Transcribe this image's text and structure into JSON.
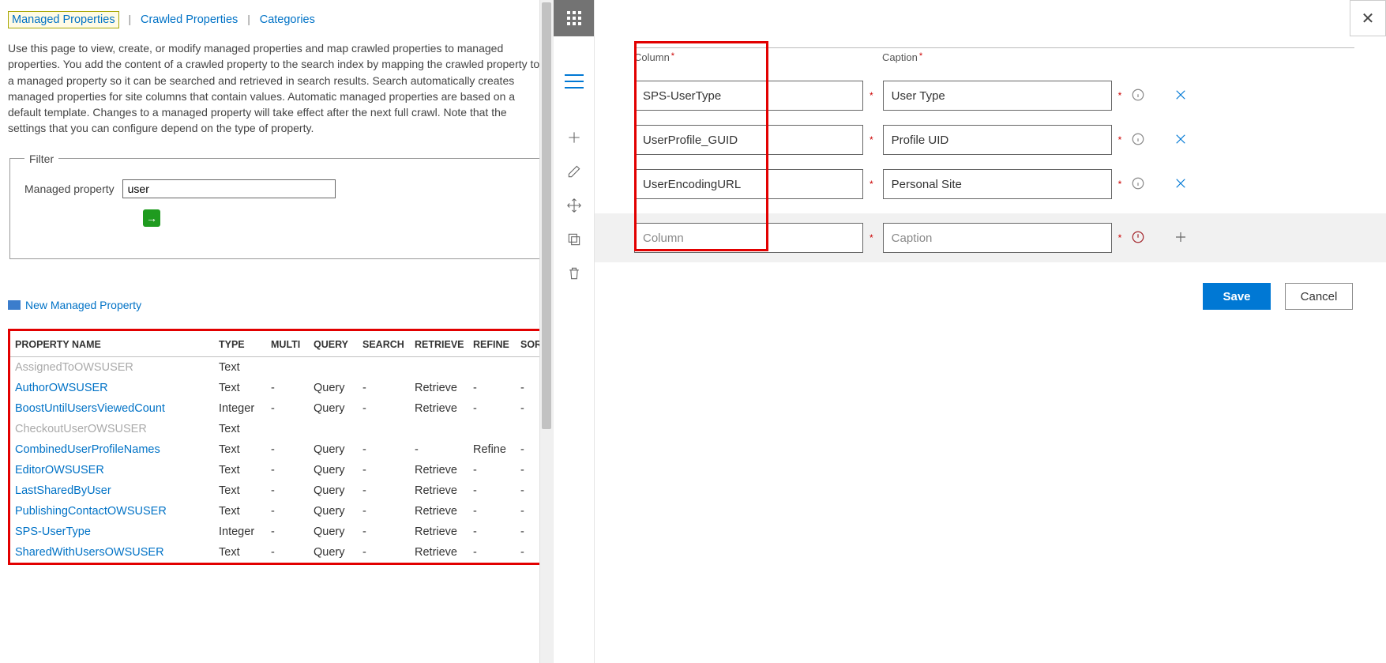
{
  "left": {
    "tabs": {
      "managed": "Managed Properties",
      "crawled": "Crawled Properties",
      "categories": "Categories"
    },
    "intro": "Use this page to view, create, or modify managed properties and map crawled properties to managed properties. You add the content of a crawled property to the search index by mapping the crawled property to a managed property so it can be searched and retrieved in search results. Search automatically creates managed properties for site columns that contain values. Automatic managed properties are based on a default template. Changes to a managed property will take effect after the next full crawl. Note that the settings that you can configure depend on the type of property.",
    "filter": {
      "legend": "Filter",
      "label": "Managed property",
      "value": "user"
    },
    "newMP": "New Managed Property",
    "table": {
      "headers": {
        "name": "PROPERTY NAME",
        "type": "TYPE",
        "multi": "MULTI",
        "query": "QUERY",
        "search": "SEARCH",
        "retrieve": "RETRIEVE",
        "refine": "REFINE",
        "sort": "SORT"
      },
      "rows": [
        {
          "name": "AssignedToOWSUSER",
          "disabled": true,
          "type": "Text",
          "multi": "",
          "query": "",
          "search": "",
          "retrieve": "",
          "refine": "",
          "sort": ""
        },
        {
          "name": "AuthorOWSUSER",
          "disabled": false,
          "type": "Text",
          "multi": "-",
          "query": "Query",
          "search": "-",
          "retrieve": "Retrieve",
          "refine": "-",
          "sort": "-"
        },
        {
          "name": "BoostUntilUsersViewedCount",
          "disabled": false,
          "type": "Integer",
          "multi": "-",
          "query": "Query",
          "search": "-",
          "retrieve": "Retrieve",
          "refine": "-",
          "sort": "-"
        },
        {
          "name": "CheckoutUserOWSUSER",
          "disabled": true,
          "type": "Text",
          "multi": "",
          "query": "",
          "search": "",
          "retrieve": "",
          "refine": "",
          "sort": ""
        },
        {
          "name": "CombinedUserProfileNames",
          "disabled": false,
          "type": "Text",
          "multi": "-",
          "query": "Query",
          "search": "-",
          "retrieve": "-",
          "refine": "Refine",
          "sort": "-"
        },
        {
          "name": "EditorOWSUSER",
          "disabled": false,
          "type": "Text",
          "multi": "-",
          "query": "Query",
          "search": "-",
          "retrieve": "Retrieve",
          "refine": "-",
          "sort": "-"
        },
        {
          "name": "LastSharedByUser",
          "disabled": false,
          "type": "Text",
          "multi": "-",
          "query": "Query",
          "search": "-",
          "retrieve": "Retrieve",
          "refine": "-",
          "sort": "-"
        },
        {
          "name": "PublishingContactOWSUSER",
          "disabled": false,
          "type": "Text",
          "multi": "-",
          "query": "Query",
          "search": "-",
          "retrieve": "Retrieve",
          "refine": "-",
          "sort": "-"
        },
        {
          "name": "SPS-UserType",
          "disabled": false,
          "type": "Integer",
          "multi": "-",
          "query": "Query",
          "search": "-",
          "retrieve": "Retrieve",
          "refine": "-",
          "sort": "-"
        },
        {
          "name": "SharedWithUsersOWSUSER",
          "disabled": false,
          "type": "Text",
          "multi": "-",
          "query": "Query",
          "search": "-",
          "retrieve": "Retrieve",
          "refine": "-",
          "sort": "-"
        }
      ]
    }
  },
  "dialog": {
    "headers": {
      "column": "Column",
      "caption": "Caption"
    },
    "rows": [
      {
        "column": "SPS-UserType",
        "caption": "User Type"
      },
      {
        "column": "UserProfile_GUID",
        "caption": "Profile UID"
      },
      {
        "column": "UserEncodingURL",
        "caption": "Personal Site"
      }
    ],
    "newRow": {
      "columnPH": "Column",
      "captionPH": "Caption"
    },
    "buttons": {
      "save": "Save",
      "cancel": "Cancel"
    }
  }
}
